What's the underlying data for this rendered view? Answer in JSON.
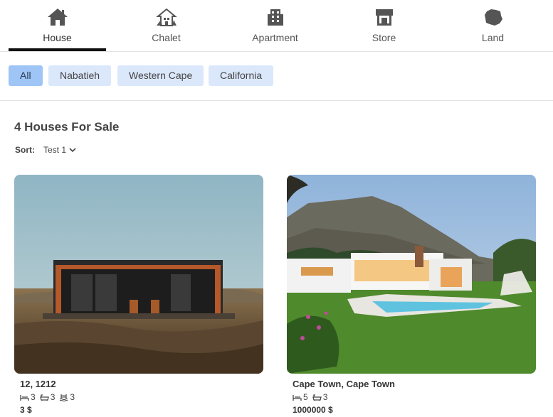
{
  "tabs": [
    {
      "label": "House",
      "icon": "house-icon",
      "active": true
    },
    {
      "label": "Chalet",
      "icon": "chalet-icon",
      "active": false
    },
    {
      "label": "Apartment",
      "icon": "building-icon",
      "active": false
    },
    {
      "label": "Store",
      "icon": "store-icon",
      "active": false
    },
    {
      "label": "Land",
      "icon": "map-icon",
      "active": false
    }
  ],
  "filters": [
    {
      "label": "All",
      "active": true
    },
    {
      "label": "Nabatieh",
      "active": false
    },
    {
      "label": "Western Cape",
      "active": false
    },
    {
      "label": "California",
      "active": false
    }
  ],
  "listing_heading": "4 Houses For Sale",
  "sort": {
    "label": "Sort:",
    "value": "Test 1"
  },
  "listings": [
    {
      "title": "12, 1212",
      "bedrooms": "3",
      "bathrooms": "3",
      "pools": "3",
      "price": "3 $",
      "photo": "container-cabin-photo"
    },
    {
      "title": "Cape Town, Cape Town",
      "bedrooms": "5",
      "bathrooms": "3",
      "price": "1000000 $",
      "photo": "villa-with-pool-photo"
    }
  ],
  "colors": {
    "chip_bg": "#dbe8fb",
    "chip_active_bg": "#9ec5f5",
    "tab_underline": "#111111"
  }
}
